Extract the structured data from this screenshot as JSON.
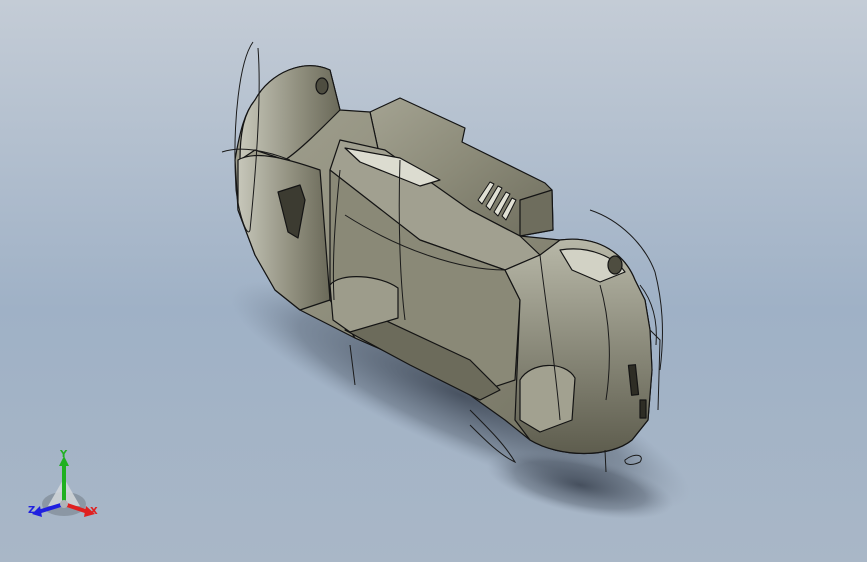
{
  "viewport": {
    "background_top": "#c4ccd6",
    "background_bottom": "#9fb1c6"
  },
  "model": {
    "body_color": "#8b8a78",
    "shade_color": "#5d5c4c",
    "highlight_color": "#d8d8cc",
    "edge_color": "#141414",
    "shadow_color": "#2b3340"
  },
  "triad": {
    "x_label": "X",
    "y_label": "Y",
    "z_label": "Z",
    "x_color": "#e02020",
    "y_color": "#20b020",
    "z_color": "#2020e0"
  }
}
